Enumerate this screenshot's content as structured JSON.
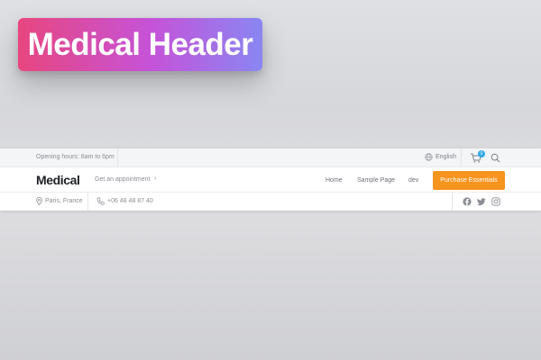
{
  "badge": {
    "title": "Medical Header",
    "gradient": [
      "#e8467f",
      "#c553d9",
      "#8a86f3"
    ]
  },
  "top_bar": {
    "hours": "Opening hours: 8am to 6pm",
    "language": "English",
    "cart_count": "0",
    "icons": [
      "globe-icon",
      "cart-icon",
      "search-icon"
    ]
  },
  "main_bar": {
    "logo": "Medical",
    "appointment": "Get an appointment",
    "appointment_arrow": "›",
    "nav": [
      "Home",
      "Sample Page",
      "dev"
    ],
    "cta_label": "Purchase Essentials",
    "cta_color": "#f7941e"
  },
  "bottom_bar": {
    "location": "Paris, France",
    "phone": "+06 48 48 87 40",
    "social_icons": [
      "facebook-icon",
      "twitter-icon",
      "instagram-icon"
    ]
  },
  "colors": {
    "badge_accent": "#2fa8e8"
  }
}
